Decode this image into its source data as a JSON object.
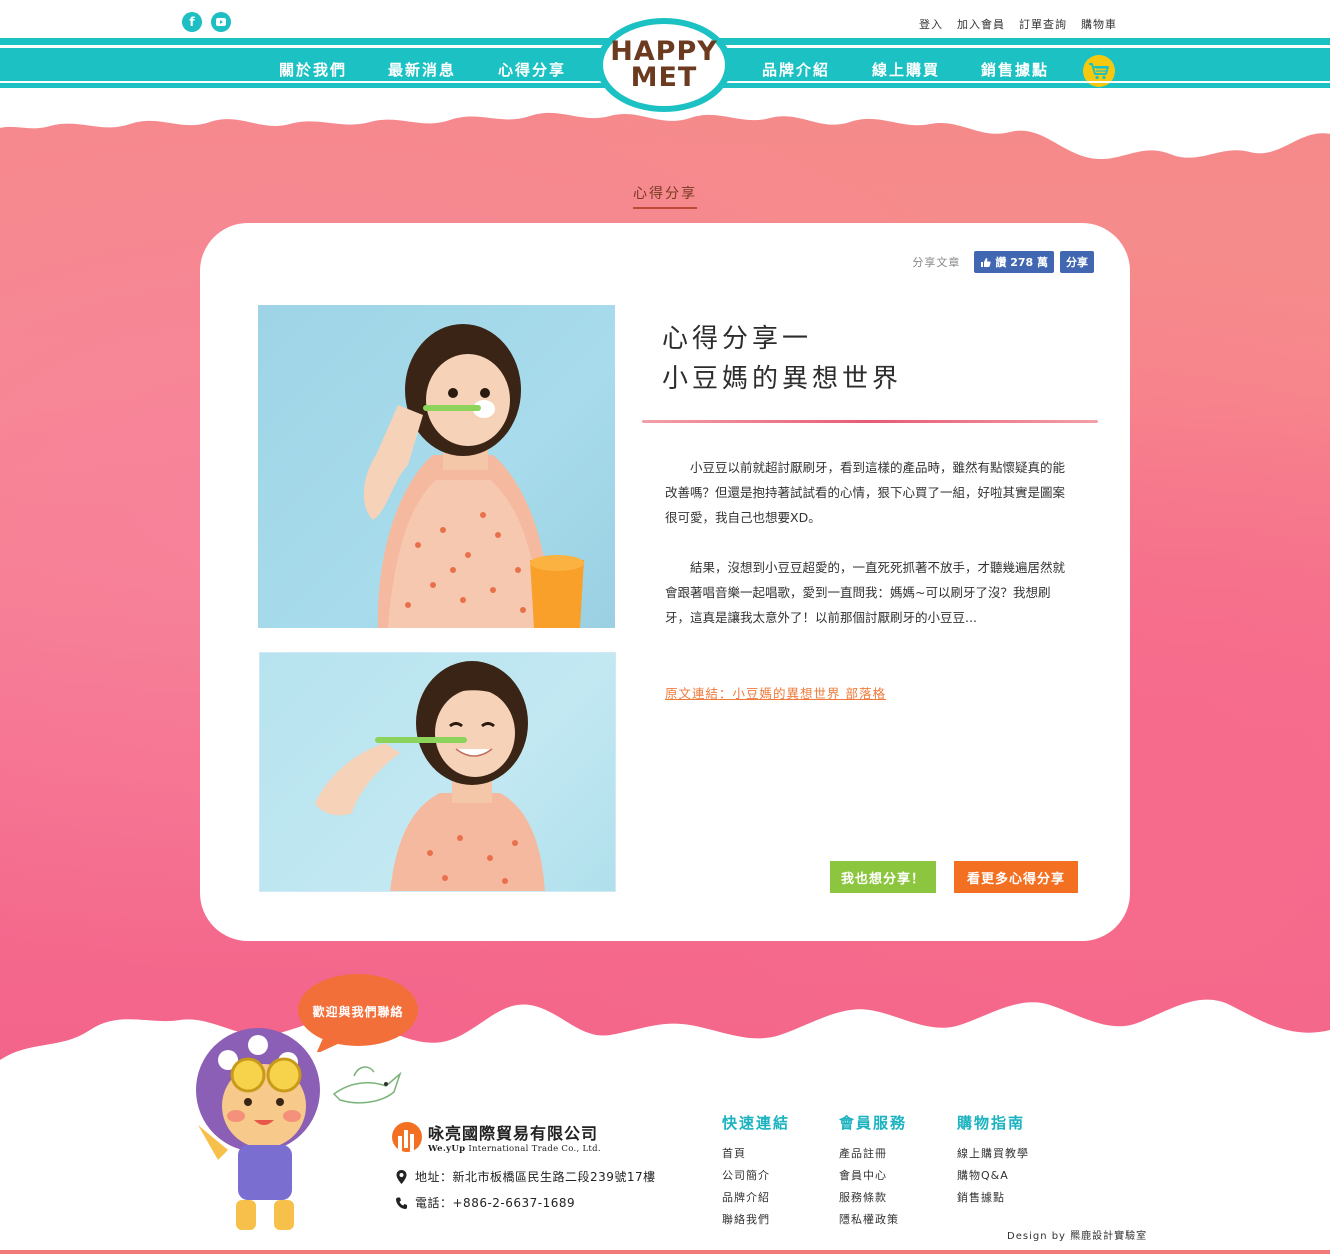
{
  "header": {
    "social": [
      {
        "name": "facebook-icon",
        "glyph": "f"
      },
      {
        "name": "youtube-icon",
        "glyph": ""
      }
    ],
    "util_links": [
      "登入",
      "加入會員",
      "訂單查詢",
      "購物車"
    ],
    "nav_left": [
      "關於我們",
      "最新消息",
      "心得分享"
    ],
    "nav_right": [
      "品牌介紹",
      "線上購買",
      "銷售據點"
    ],
    "logo_line1": "HAPPY",
    "logo_line2": "MET"
  },
  "page": {
    "section_title": "心得分享",
    "share": {
      "label": "分享文章",
      "like_label": "讚 278 萬",
      "share_label": "分享"
    },
    "post": {
      "title_line1": "心得分享一",
      "title_line2": "小豆媽的異想世界",
      "paragraph1": "小豆豆以前就超討厭刷牙，看到這樣的產品時，雖然有點懷疑真的能改善嗎？但還是抱持著試試看的心情，狠下心買了一組，好啦其實是圖案很可愛，我自己也想要XD。",
      "paragraph2": "結果，沒想到小豆豆超愛的，一直死死抓著不放手，才聽幾遍居然就會跟著唱音樂一起唱歌，愛到一直問我：媽媽~可以刷牙了沒？我想刷牙，這真是讓我太意外了！以前那個討厭刷牙的小豆豆...",
      "source_link": "原文連結：小豆媽的異想世界  部落格"
    },
    "buttons": {
      "share": "我也想分享！",
      "more": "看更多心得分享"
    }
  },
  "footer": {
    "bubble_text": "歡迎與我們聯絡",
    "company_name": "咏亮國際貿易有限公司",
    "company_en_brand": "We.yUp",
    "company_en": "International Trade Co., Ltd.",
    "address": "地址：新北市板橋區民生路二段239號17樓",
    "phone": "電話：+886-2-6637-1689",
    "columns": [
      {
        "title": "快速連結",
        "links": [
          "首頁",
          "公司簡介",
          "品牌介紹",
          "聯絡我們"
        ]
      },
      {
        "title": "會員服務",
        "links": [
          "產品註冊",
          "會員中心",
          "服務條款",
          "隱私權政策"
        ]
      },
      {
        "title": "購物指南",
        "links": [
          "線上購買教學",
          "購物Q&A",
          "銷售據點"
        ]
      }
    ],
    "design_credit": "Design by 羆鹿設計實驗室"
  },
  "colors": {
    "teal": "#1cc1c3",
    "pink": "#f78c8c",
    "green_button": "#8cc63f",
    "orange_button": "#f36f21",
    "facebook_blue": "#4267b2"
  }
}
